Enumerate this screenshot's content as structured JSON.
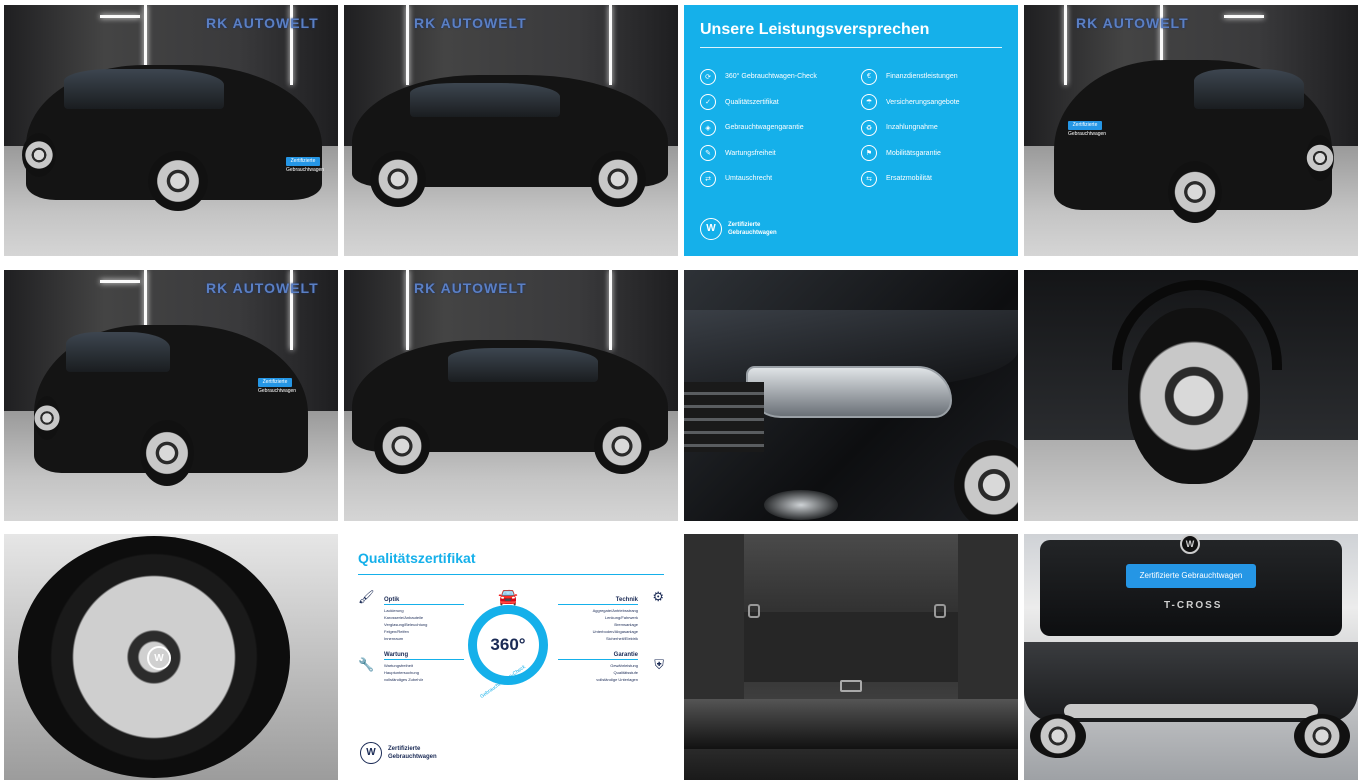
{
  "gallery": {
    "brand_watermark": "RK AUTOWELT",
    "plate_text": "Zertifizierte Gebrauchtwagen",
    "model_badge": "T-CROSS",
    "images": [
      {
        "name": "front-left-three-quarter",
        "kind": "photo"
      },
      {
        "name": "right-side-profile",
        "kind": "photo"
      },
      {
        "name": "leistungsversprechen-card",
        "kind": "info"
      },
      {
        "name": "rear-right-three-quarter",
        "kind": "photo"
      },
      {
        "name": "rear-left-three-quarter",
        "kind": "photo"
      },
      {
        "name": "left-side-profile",
        "kind": "photo"
      },
      {
        "name": "headlight-detail",
        "kind": "photo"
      },
      {
        "name": "front-wheel-detail",
        "kind": "photo"
      },
      {
        "name": "alloy-wheel-closeup",
        "kind": "photo"
      },
      {
        "name": "qualitaetszertifikat-card",
        "kind": "info"
      },
      {
        "name": "trunk-interior",
        "kind": "photo"
      },
      {
        "name": "rear-tailgate",
        "kind": "photo"
      }
    ]
  },
  "promise_card": {
    "title": "Unsere Leistungsversprechen",
    "left_items": [
      "360° Gebrauchtwagen-Check",
      "Qualitätszertifikat",
      "Gebrauchtwagengarantie",
      "Wartungsfreiheit",
      "Umtauschrecht"
    ],
    "right_items": [
      "Finanzdienstleistungen",
      "Versicherungsangebote",
      "Inzahlungnahme",
      "Mobilitätsgarantie",
      "Ersatzmobilität"
    ],
    "footer_line1": "Zertifizierte",
    "footer_line2": "Gebrauchtwagen",
    "colors": {
      "background": "#15b0ea",
      "text": "#ffffff"
    }
  },
  "cert_card": {
    "title": "Qualitätszertifikat",
    "center_value": "360°",
    "ring_label": "Gebrauchtwagen-Check",
    "optik": {
      "title": "Optik",
      "items": [
        "Lackierung",
        "Karosserie/Anbauteile",
        "Verglasung/Beleuchtung",
        "Felgen/Reifen",
        "Innenraum"
      ]
    },
    "technik": {
      "title": "Technik",
      "items": [
        "Aggregate/Antriebsstrang",
        "Lenkung/Fahrwerk",
        "Bremsanlage",
        "Unterboden/Abgasanlage",
        "Sicherheit/Elektrik"
      ]
    },
    "wartung": {
      "title": "Wartung",
      "items": [
        "Wartungsfreiheit",
        "Hauptuntersuchung",
        "vollständiges Zubehör"
      ]
    },
    "garantie": {
      "title": "Garantie",
      "items": [
        "Gewährleistung",
        "Qualitätsstufe",
        "vollständige Unterlagen"
      ]
    },
    "footer_line1": "Zertifizierte",
    "footer_line2": "Gebrauchtwagen",
    "colors": {
      "accent": "#15b0ea",
      "text": "#1a2a55"
    }
  }
}
